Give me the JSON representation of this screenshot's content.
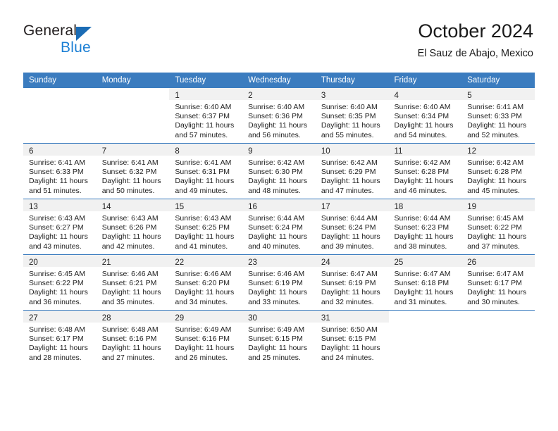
{
  "brand": {
    "name_top": "General",
    "name_bottom": "Blue",
    "accent_color": "#1b7fd4",
    "triangle_color": "#1b6cb5"
  },
  "header": {
    "title": "October 2024",
    "subtitle": "El Sauz de Abajo, Mexico"
  },
  "theme": {
    "header_row_bg": "#3b7cbf",
    "day_band_bg": "#f1f1f1",
    "divider_color": "#3b7cbf",
    "text_color": "#222222"
  },
  "weekday_headers": [
    "Sunday",
    "Monday",
    "Tuesday",
    "Wednesday",
    "Thursday",
    "Friday",
    "Saturday"
  ],
  "labels": {
    "sunrise_prefix": "Sunrise:",
    "sunset_prefix": "Sunset:",
    "daylight_prefix": "Daylight:"
  },
  "weeks": [
    [
      {
        "day": "",
        "sunrise": "",
        "sunset": "",
        "daylight_line1": "",
        "daylight_line2": ""
      },
      {
        "day": "",
        "sunrise": "",
        "sunset": "",
        "daylight_line1": "",
        "daylight_line2": ""
      },
      {
        "day": "1",
        "sunrise": "Sunrise: 6:40 AM",
        "sunset": "Sunset: 6:37 PM",
        "daylight_line1": "Daylight: 11 hours",
        "daylight_line2": "and 57 minutes."
      },
      {
        "day": "2",
        "sunrise": "Sunrise: 6:40 AM",
        "sunset": "Sunset: 6:36 PM",
        "daylight_line1": "Daylight: 11 hours",
        "daylight_line2": "and 56 minutes."
      },
      {
        "day": "3",
        "sunrise": "Sunrise: 6:40 AM",
        "sunset": "Sunset: 6:35 PM",
        "daylight_line1": "Daylight: 11 hours",
        "daylight_line2": "and 55 minutes."
      },
      {
        "day": "4",
        "sunrise": "Sunrise: 6:40 AM",
        "sunset": "Sunset: 6:34 PM",
        "daylight_line1": "Daylight: 11 hours",
        "daylight_line2": "and 54 minutes."
      },
      {
        "day": "5",
        "sunrise": "Sunrise: 6:41 AM",
        "sunset": "Sunset: 6:33 PM",
        "daylight_line1": "Daylight: 11 hours",
        "daylight_line2": "and 52 minutes."
      }
    ],
    [
      {
        "day": "6",
        "sunrise": "Sunrise: 6:41 AM",
        "sunset": "Sunset: 6:33 PM",
        "daylight_line1": "Daylight: 11 hours",
        "daylight_line2": "and 51 minutes."
      },
      {
        "day": "7",
        "sunrise": "Sunrise: 6:41 AM",
        "sunset": "Sunset: 6:32 PM",
        "daylight_line1": "Daylight: 11 hours",
        "daylight_line2": "and 50 minutes."
      },
      {
        "day": "8",
        "sunrise": "Sunrise: 6:41 AM",
        "sunset": "Sunset: 6:31 PM",
        "daylight_line1": "Daylight: 11 hours",
        "daylight_line2": "and 49 minutes."
      },
      {
        "day": "9",
        "sunrise": "Sunrise: 6:42 AM",
        "sunset": "Sunset: 6:30 PM",
        "daylight_line1": "Daylight: 11 hours",
        "daylight_line2": "and 48 minutes."
      },
      {
        "day": "10",
        "sunrise": "Sunrise: 6:42 AM",
        "sunset": "Sunset: 6:29 PM",
        "daylight_line1": "Daylight: 11 hours",
        "daylight_line2": "and 47 minutes."
      },
      {
        "day": "11",
        "sunrise": "Sunrise: 6:42 AM",
        "sunset": "Sunset: 6:28 PM",
        "daylight_line1": "Daylight: 11 hours",
        "daylight_line2": "and 46 minutes."
      },
      {
        "day": "12",
        "sunrise": "Sunrise: 6:42 AM",
        "sunset": "Sunset: 6:28 PM",
        "daylight_line1": "Daylight: 11 hours",
        "daylight_line2": "and 45 minutes."
      }
    ],
    [
      {
        "day": "13",
        "sunrise": "Sunrise: 6:43 AM",
        "sunset": "Sunset: 6:27 PM",
        "daylight_line1": "Daylight: 11 hours",
        "daylight_line2": "and 43 minutes."
      },
      {
        "day": "14",
        "sunrise": "Sunrise: 6:43 AM",
        "sunset": "Sunset: 6:26 PM",
        "daylight_line1": "Daylight: 11 hours",
        "daylight_line2": "and 42 minutes."
      },
      {
        "day": "15",
        "sunrise": "Sunrise: 6:43 AM",
        "sunset": "Sunset: 6:25 PM",
        "daylight_line1": "Daylight: 11 hours",
        "daylight_line2": "and 41 minutes."
      },
      {
        "day": "16",
        "sunrise": "Sunrise: 6:44 AM",
        "sunset": "Sunset: 6:24 PM",
        "daylight_line1": "Daylight: 11 hours",
        "daylight_line2": "and 40 minutes."
      },
      {
        "day": "17",
        "sunrise": "Sunrise: 6:44 AM",
        "sunset": "Sunset: 6:24 PM",
        "daylight_line1": "Daylight: 11 hours",
        "daylight_line2": "and 39 minutes."
      },
      {
        "day": "18",
        "sunrise": "Sunrise: 6:44 AM",
        "sunset": "Sunset: 6:23 PM",
        "daylight_line1": "Daylight: 11 hours",
        "daylight_line2": "and 38 minutes."
      },
      {
        "day": "19",
        "sunrise": "Sunrise: 6:45 AM",
        "sunset": "Sunset: 6:22 PM",
        "daylight_line1": "Daylight: 11 hours",
        "daylight_line2": "and 37 minutes."
      }
    ],
    [
      {
        "day": "20",
        "sunrise": "Sunrise: 6:45 AM",
        "sunset": "Sunset: 6:22 PM",
        "daylight_line1": "Daylight: 11 hours",
        "daylight_line2": "and 36 minutes."
      },
      {
        "day": "21",
        "sunrise": "Sunrise: 6:46 AM",
        "sunset": "Sunset: 6:21 PM",
        "daylight_line1": "Daylight: 11 hours",
        "daylight_line2": "and 35 minutes."
      },
      {
        "day": "22",
        "sunrise": "Sunrise: 6:46 AM",
        "sunset": "Sunset: 6:20 PM",
        "daylight_line1": "Daylight: 11 hours",
        "daylight_line2": "and 34 minutes."
      },
      {
        "day": "23",
        "sunrise": "Sunrise: 6:46 AM",
        "sunset": "Sunset: 6:19 PM",
        "daylight_line1": "Daylight: 11 hours",
        "daylight_line2": "and 33 minutes."
      },
      {
        "day": "24",
        "sunrise": "Sunrise: 6:47 AM",
        "sunset": "Sunset: 6:19 PM",
        "daylight_line1": "Daylight: 11 hours",
        "daylight_line2": "and 32 minutes."
      },
      {
        "day": "25",
        "sunrise": "Sunrise: 6:47 AM",
        "sunset": "Sunset: 6:18 PM",
        "daylight_line1": "Daylight: 11 hours",
        "daylight_line2": "and 31 minutes."
      },
      {
        "day": "26",
        "sunrise": "Sunrise: 6:47 AM",
        "sunset": "Sunset: 6:17 PM",
        "daylight_line1": "Daylight: 11 hours",
        "daylight_line2": "and 30 minutes."
      }
    ],
    [
      {
        "day": "27",
        "sunrise": "Sunrise: 6:48 AM",
        "sunset": "Sunset: 6:17 PM",
        "daylight_line1": "Daylight: 11 hours",
        "daylight_line2": "and 28 minutes."
      },
      {
        "day": "28",
        "sunrise": "Sunrise: 6:48 AM",
        "sunset": "Sunset: 6:16 PM",
        "daylight_line1": "Daylight: 11 hours",
        "daylight_line2": "and 27 minutes."
      },
      {
        "day": "29",
        "sunrise": "Sunrise: 6:49 AM",
        "sunset": "Sunset: 6:16 PM",
        "daylight_line1": "Daylight: 11 hours",
        "daylight_line2": "and 26 minutes."
      },
      {
        "day": "30",
        "sunrise": "Sunrise: 6:49 AM",
        "sunset": "Sunset: 6:15 PM",
        "daylight_line1": "Daylight: 11 hours",
        "daylight_line2": "and 25 minutes."
      },
      {
        "day": "31",
        "sunrise": "Sunrise: 6:50 AM",
        "sunset": "Sunset: 6:15 PM",
        "daylight_line1": "Daylight: 11 hours",
        "daylight_line2": "and 24 minutes."
      },
      {
        "day": "",
        "sunrise": "",
        "sunset": "",
        "daylight_line1": "",
        "daylight_line2": ""
      },
      {
        "day": "",
        "sunrise": "",
        "sunset": "",
        "daylight_line1": "",
        "daylight_line2": ""
      }
    ]
  ]
}
